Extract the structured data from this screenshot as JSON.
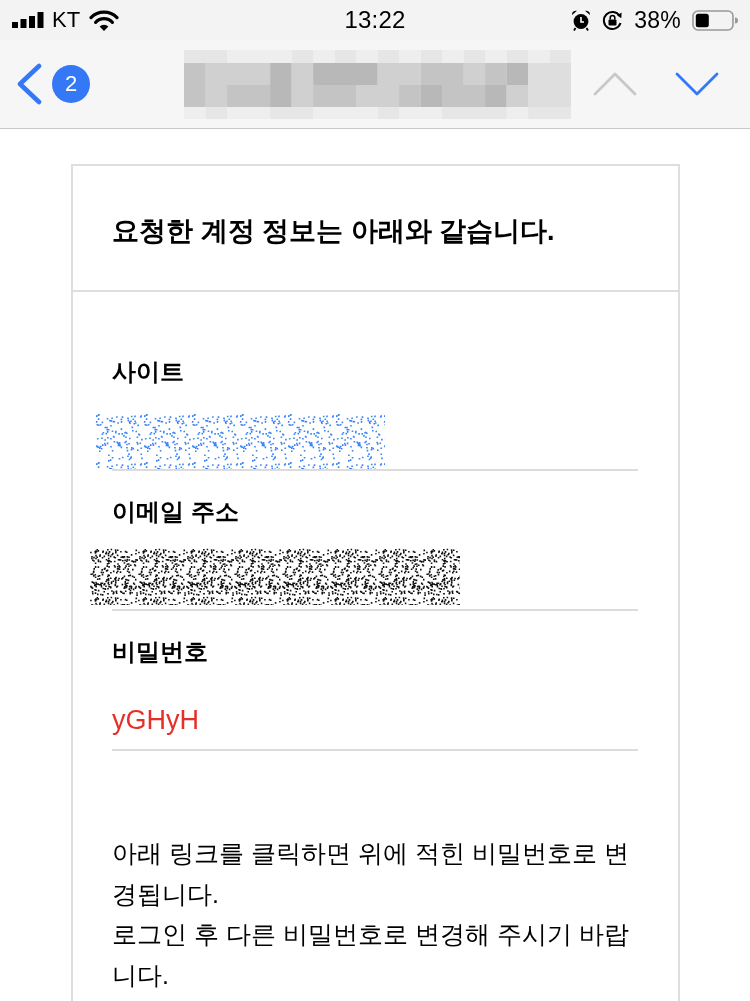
{
  "status_bar": {
    "carrier": "KT",
    "time": "13:22",
    "battery_percent": "38%"
  },
  "nav_bar": {
    "back_badge": "2",
    "buttons": [
      {
        "kind": "up",
        "disabled": true
      },
      {
        "kind": "down",
        "disabled": false
      }
    ]
  },
  "message": {
    "heading": "요청한 계정 정보는 아래와 같습니다.",
    "fields": [
      {
        "label": "사이트",
        "kind": "redacted_link"
      },
      {
        "label": "이메일 주소",
        "kind": "redacted_text"
      },
      {
        "label": "비밀번호",
        "kind": "text",
        "value": "yGHyH"
      }
    ],
    "paragraphs": [
      "아래 링크를 클릭하면 위에 적힌 비밀번호로 변경됩니다.",
      "로그인 후 다른 비밀번호로 변경해 주시기 바랍니다."
    ]
  }
}
